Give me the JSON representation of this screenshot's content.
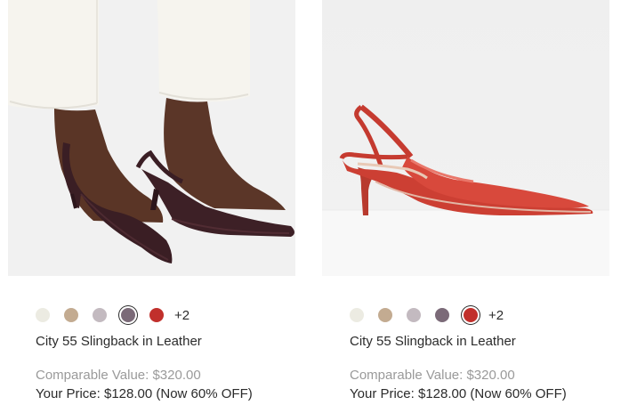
{
  "products": [
    {
      "name": "City 55 Slingback in Leather",
      "image_alt": "Model wearing City 55 Slingback in dark plum leather",
      "swatches": [
        {
          "name": "cream",
          "color": "#ecebe2",
          "selected": false
        },
        {
          "name": "tan",
          "color": "#c3ab91",
          "selected": false
        },
        {
          "name": "light-mauve",
          "color": "#c3bac0",
          "selected": false
        },
        {
          "name": "plum",
          "color": "#7b6a78",
          "selected": true
        },
        {
          "name": "red",
          "color": "#c1302c",
          "selected": false
        }
      ],
      "more_colors": "+2",
      "comparable_value": "Comparable Value: $320.00",
      "your_price": "Your Price: $128.00 (Now 60% OFF)"
    },
    {
      "name": "City 55 Slingback in Leather",
      "image_alt": "City 55 Slingback in red leather, side view",
      "swatches": [
        {
          "name": "cream",
          "color": "#ecebe2",
          "selected": false
        },
        {
          "name": "tan",
          "color": "#c3ab91",
          "selected": false
        },
        {
          "name": "light-mauve",
          "color": "#c3bac0",
          "selected": false
        },
        {
          "name": "plum",
          "color": "#7b6a78",
          "selected": false
        },
        {
          "name": "red",
          "color": "#c1302c",
          "selected": true
        }
      ],
      "more_colors": "+2",
      "comparable_value": "Comparable Value: $320.00",
      "your_price": "Your Price: $128.00 (Now 60% OFF)"
    }
  ]
}
